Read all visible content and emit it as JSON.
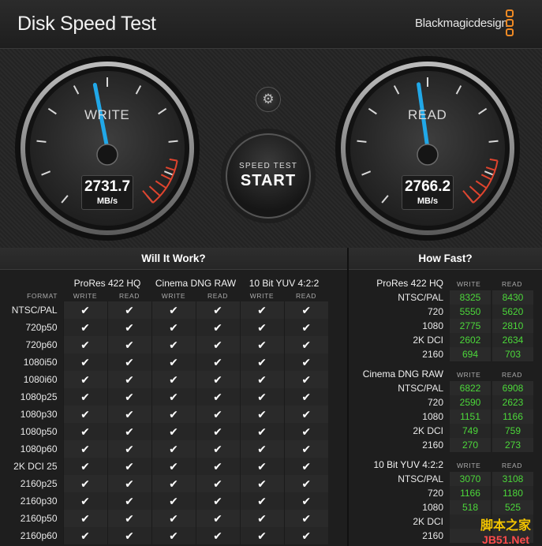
{
  "titlebar": {
    "title": "Disk Speed Test",
    "brand": "Blackmagicdesign"
  },
  "gauges": {
    "write": {
      "label": "WRITE",
      "value": "2731.7",
      "unit": "MB/s"
    },
    "read": {
      "label": "READ",
      "value": "2766.2",
      "unit": "MB/s"
    }
  },
  "center_button": {
    "small": "SPEED TEST",
    "big": "START"
  },
  "settings_icon": "gear-icon",
  "will_it_work": {
    "title": "Will It Work?",
    "format_label": "FORMAT",
    "codecs": [
      "ProRes 422 HQ",
      "Cinema DNG RAW",
      "10 Bit YUV 4:2:2"
    ],
    "write_label": "WRITE",
    "read_label": "READ",
    "check": "✔",
    "rows": [
      "NTSC/PAL",
      "720p50",
      "720p60",
      "1080i50",
      "1080i60",
      "1080p25",
      "1080p30",
      "1080p50",
      "1080p60",
      "2K DCI 25",
      "2160p25",
      "2160p30",
      "2160p50",
      "2160p60"
    ]
  },
  "how_fast": {
    "title": "How Fast?",
    "write_label": "WRITE",
    "read_label": "READ",
    "groups": [
      {
        "name": "ProRes 422 HQ",
        "rows": [
          {
            "label": "NTSC/PAL",
            "write": "8325",
            "read": "8430"
          },
          {
            "label": "720",
            "write": "5550",
            "read": "5620"
          },
          {
            "label": "1080",
            "write": "2775",
            "read": "2810"
          },
          {
            "label": "2K DCI",
            "write": "2602",
            "read": "2634"
          },
          {
            "label": "2160",
            "write": "694",
            "read": "703"
          }
        ]
      },
      {
        "name": "Cinema DNG RAW",
        "rows": [
          {
            "label": "NTSC/PAL",
            "write": "6822",
            "read": "6908"
          },
          {
            "label": "720",
            "write": "2590",
            "read": "2623"
          },
          {
            "label": "1080",
            "write": "1151",
            "read": "1166"
          },
          {
            "label": "2K DCI",
            "write": "749",
            "read": "759"
          },
          {
            "label": "2160",
            "write": "270",
            "read": "273"
          }
        ]
      },
      {
        "name": "10 Bit YUV 4:2:2",
        "rows": [
          {
            "label": "NTSC/PAL",
            "write": "3070",
            "read": "3108"
          },
          {
            "label": "720",
            "write": "1166",
            "read": "1180"
          },
          {
            "label": "1080",
            "write": "518",
            "read": "525"
          },
          {
            "label": "2K DCI",
            "write": "",
            "read": ""
          },
          {
            "label": "2160",
            "write": "",
            "read": ""
          }
        ]
      }
    ]
  },
  "watermark": {
    "line1": "脚本之家",
    "line2": "JB51.Net"
  },
  "colors": {
    "accent_needle": "#21a8e8",
    "redline": "#e0442e",
    "value_green": "#4cd83a",
    "brand_orange": "#f08a24"
  }
}
